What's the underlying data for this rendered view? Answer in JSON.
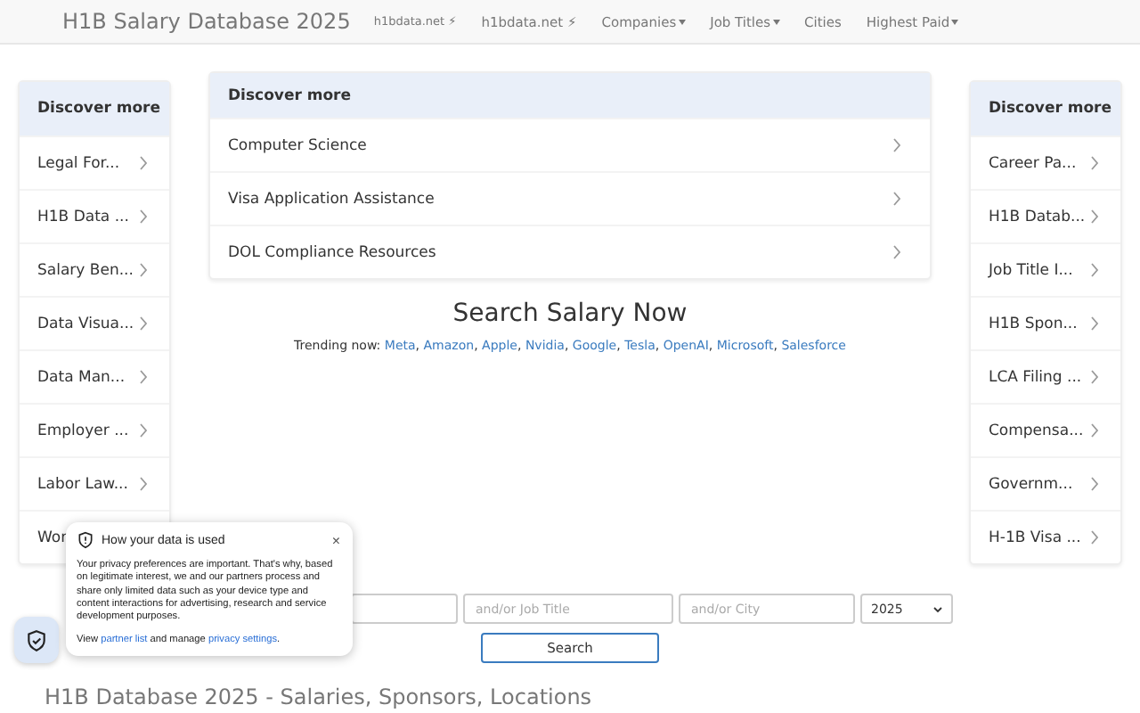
{
  "navbar": {
    "brand": "H1B Salary Database 2025",
    "links": [
      {
        "label": "h1bdata.net ⚡",
        "kind": "small",
        "dropdown": false
      },
      {
        "label": "h1bdata.net ⚡",
        "kind": "plain",
        "dropdown": false
      },
      {
        "label": "Companies",
        "kind": "plain",
        "dropdown": true
      },
      {
        "label": "Job Titles",
        "kind": "plain",
        "dropdown": true
      },
      {
        "label": "Cities",
        "kind": "plain",
        "dropdown": false
      },
      {
        "label": "Highest Paid",
        "kind": "plain",
        "dropdown": true
      }
    ]
  },
  "left_sidebar": {
    "title": "Discover more",
    "items": [
      "Legal For...",
      "H1B Data ...",
      "Salary Ben...",
      "Data Visua...",
      "Data Man...",
      "Employer ...",
      "Labor Law...",
      "Wor"
    ]
  },
  "center_panel": {
    "title": "Discover more",
    "items": [
      "Computer Science",
      "Visa Application Assistance",
      "DOL Compliance Resources"
    ]
  },
  "right_sidebar": {
    "title": "Discover more",
    "items": [
      "Career Pa...",
      "H1B Datab...",
      "Job Title I...",
      "H1B Spon...",
      "LCA Filing ...",
      "Compensa...",
      "Governm...",
      "H-1B Visa ..."
    ]
  },
  "search": {
    "title": "Search Salary Now",
    "trending_label": "Trending now:",
    "trending": [
      "Meta",
      "Amazon",
      "Apple",
      "Nvidia",
      "Google",
      "Tesla",
      "OpenAI",
      "Microsoft",
      "Salesforce"
    ],
    "separator": ",",
    "fields": [
      {
        "kind": "text"
      },
      {
        "kind": "text",
        "placeholder": "and/or Job Title"
      },
      {
        "kind": "text",
        "placeholder": "and/or City"
      }
    ],
    "year": "2025",
    "button": "Search"
  },
  "footer_heading": "H1B Database 2025 - Salaries, Sponsors, Locations",
  "privacy_popup": {
    "title": "How your data is used",
    "body": "Your privacy preferences are important. That's why, based on legitimate interest, we and our partners process and share only limited data such as your device type and content interactions for advertising, research and service development purposes.",
    "footer_parts": [
      "View",
      "partner list",
      "and manage",
      "privacy settings",
      "."
    ],
    "close": "×"
  }
}
